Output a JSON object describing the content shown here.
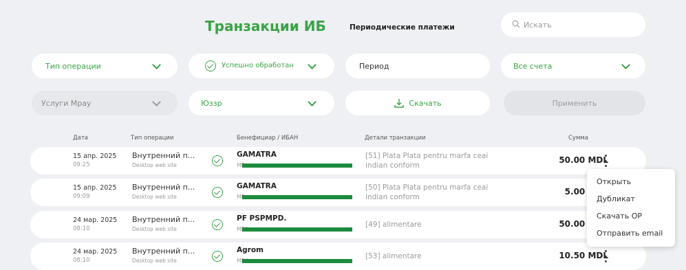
{
  "header": {
    "title": "Транзакции ИБ",
    "periodic_label": "Периодические платежи",
    "search_placeholder": "Искать"
  },
  "filters": {
    "operation_type": "Тип операции",
    "status": "Успешно обработан",
    "period": "Период",
    "accounts": "Все счета",
    "services": "Услуги Мрау",
    "provider": "Юззр",
    "download": "Скачать",
    "apply": "Применить"
  },
  "table": {
    "headers": [
      "Дата",
      "Тип операции",
      "Бенефициар / ИБАН",
      "Детали транзакции",
      "Сумма"
    ],
    "rows": [
      {
        "date": "15 апр. 2025",
        "time": "09:25",
        "type": "Внутренний п...",
        "site": "Desktop web site",
        "benef": "GAMATRA",
        "iban": "MD",
        "details": "[51] Plata Plata pentru marfa ceai indian conform",
        "amount": "50.00 MDL"
      },
      {
        "date": "15 апр. 2025",
        "time": "09:09",
        "type": "Внутренний п...",
        "site": "Desktop web site",
        "benef": "GAMATRA",
        "iban": "MD",
        "details": "[50] Plata Plata pentru marfa ceai indian conform",
        "amount": "5.00 MDL"
      },
      {
        "date": "24 мар. 2025",
        "time": "08:10",
        "type": "Внутренний п...",
        "site": "Desktop web site",
        "benef": "PF PSPMPD.",
        "iban": "MD9",
        "details": "[49] alimentare",
        "amount": "50.00 MDL"
      },
      {
        "date": "24 мар. 2025",
        "time": "08:10",
        "type": "Внутренний п...",
        "site": "Desktop web site",
        "benef": "Agrom",
        "iban": "MD4",
        "details": "[53] alimentare",
        "amount": "10.50 MDL"
      }
    ]
  },
  "context_menu": [
    "Открыть",
    "Дубликат",
    "Скачать OP",
    "Отправить email"
  ],
  "colors": {
    "accent": "#3aa346",
    "background": "#eef0f3",
    "redaction": "#1d8b3e"
  },
  "icons": {
    "search": "search-icon",
    "check": "check-circle-icon",
    "chevron": "chevron-down-icon",
    "download": "download-icon",
    "more": "kebab-menu-icon"
  }
}
